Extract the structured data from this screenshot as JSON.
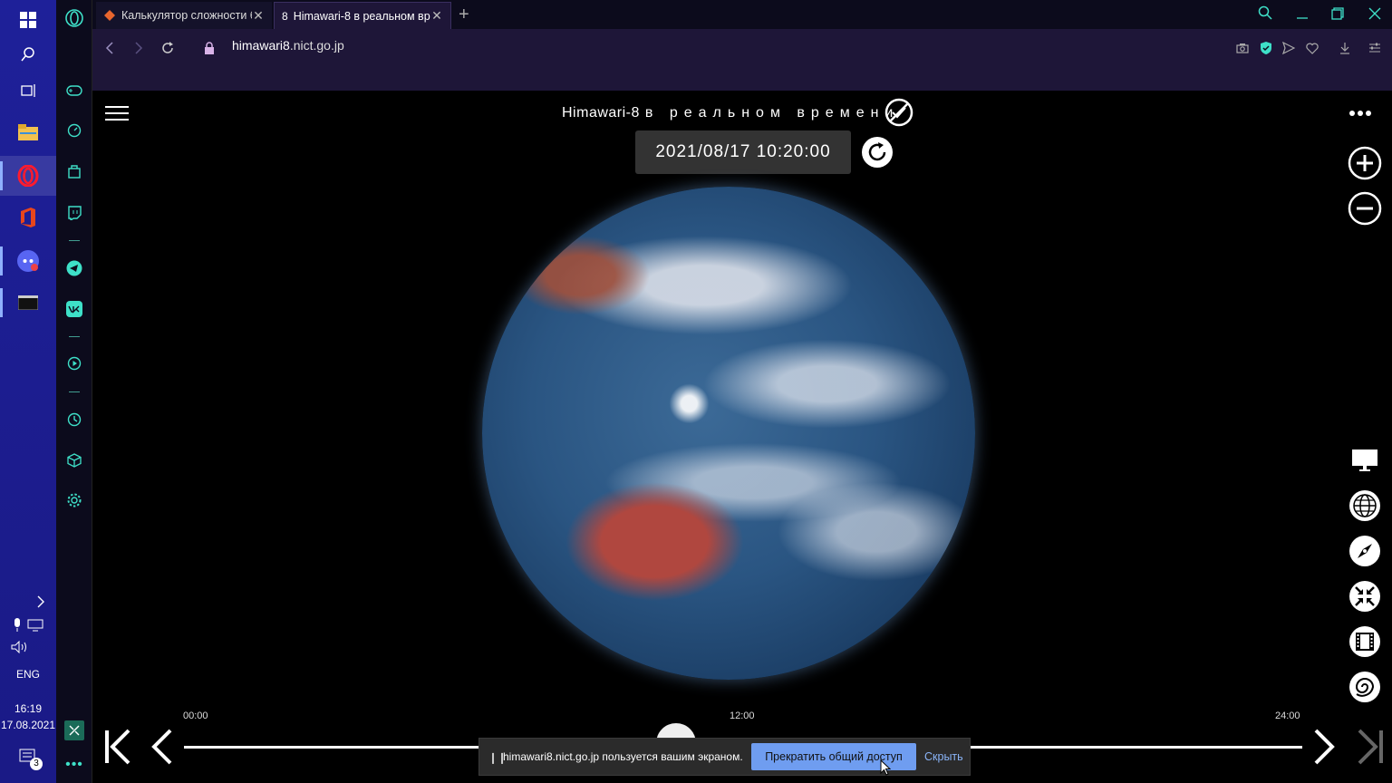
{
  "taskbar": {
    "language": "ENG",
    "time": "16:19",
    "date": "17.08.2021",
    "notifications": "3",
    "apps": [
      {
        "name": "windows-start-icon"
      },
      {
        "name": "search-icon"
      },
      {
        "name": "task-view-icon"
      },
      {
        "name": "file-explorer-icon"
      },
      {
        "name": "opera-icon"
      },
      {
        "name": "office-icon"
      },
      {
        "name": "discord-icon"
      },
      {
        "name": "terminal-icon"
      }
    ]
  },
  "tabs": [
    {
      "title": "Калькулятор сложности б",
      "active": false
    },
    {
      "title": "Himawari-8 в реальном вр",
      "active": true
    }
  ],
  "address": {
    "domain": "himawari8",
    "rest": ".nict.go.jp"
  },
  "page": {
    "title_latin": "Himawari-8",
    "title_ru": "в реальном времени",
    "datetime": "2021/08/17 10:20:00",
    "timeline": {
      "start_label": "00:00",
      "mid_label": "12:00",
      "end_label": "24:00",
      "position": 0.44
    }
  },
  "sharebar": {
    "message": "himawari8.nict.go.jp пользуется вашим экраном.",
    "stop_label": "Прекратить общий доступ",
    "hide_label": "Скрыть"
  },
  "colors": {
    "taskbar": "#1d1a8a",
    "opera_accent": "#3ee0c8",
    "share_button": "#6f9df0"
  }
}
